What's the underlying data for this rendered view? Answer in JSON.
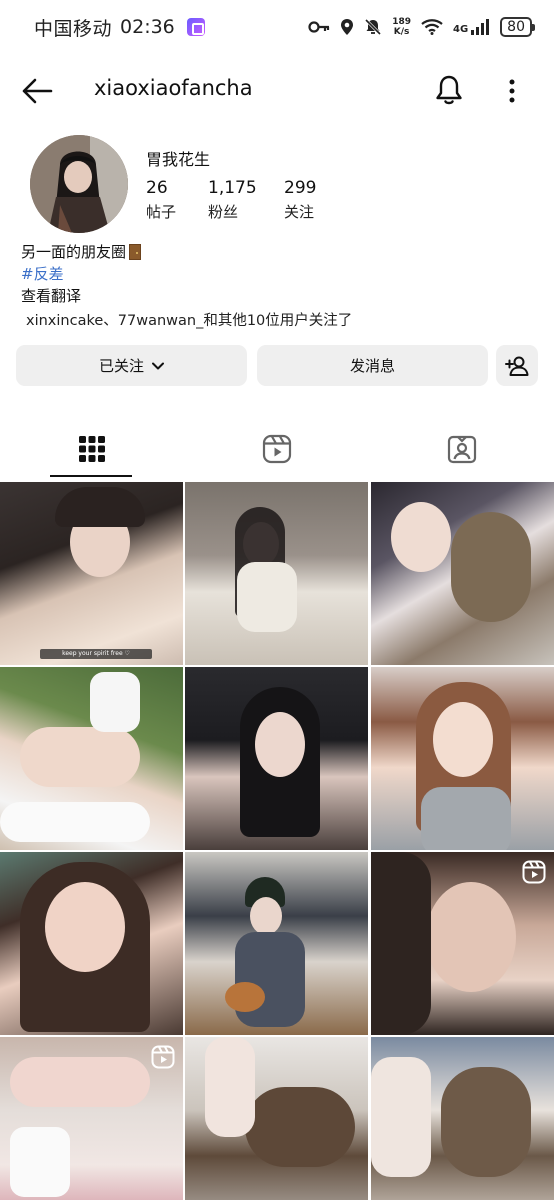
{
  "status_bar": {
    "carrier": "中国移动",
    "time": "02:36",
    "net_speed_value": "189",
    "net_speed_unit": "K/s",
    "network_type": "4G",
    "battery": "80"
  },
  "header": {
    "username": "xiaoxiaofancha"
  },
  "profile": {
    "display_name": "胃我花生",
    "stats": {
      "posts_count": "26",
      "posts_label": "帖子",
      "followers_count": "1,175",
      "followers_label": "粉丝",
      "following_count": "299",
      "following_label": "关注"
    },
    "bio_line1": "另一面的朋友圈",
    "hashtag": "#反差",
    "translate_link": "查看翻译",
    "followed_by": "xinxincake、77wanwan_和其他10位用户关注了"
  },
  "actions": {
    "following_label": "已关注",
    "message_label": "发消息"
  },
  "tabs": [
    {
      "icon": "grid-icon",
      "selected": true
    },
    {
      "icon": "reels-icon",
      "selected": false
    },
    {
      "icon": "tagged-icon",
      "selected": false
    }
  ],
  "grid": {
    "posts": [
      {
        "caption": "keep your spirit free ♡",
        "type": "photo"
      },
      {
        "type": "photo"
      },
      {
        "type": "photo"
      },
      {
        "type": "photo"
      },
      {
        "type": "photo"
      },
      {
        "type": "photo"
      },
      {
        "type": "photo"
      },
      {
        "type": "photo"
      },
      {
        "type": "reel"
      },
      {
        "type": "reel"
      },
      {
        "type": "photo"
      },
      {
        "type": "photo"
      }
    ]
  },
  "colors": {
    "hashtag": "#3b6fc8",
    "button_bg": "#efefef",
    "text": "#111111"
  }
}
